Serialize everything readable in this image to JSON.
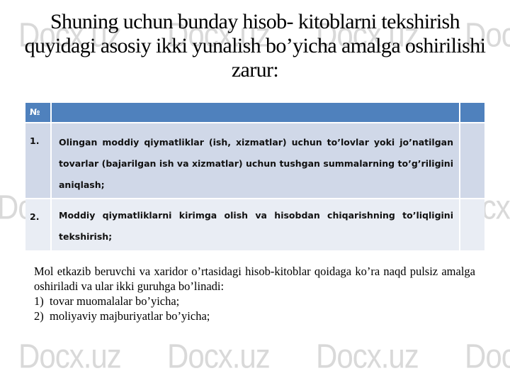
{
  "watermark": {
    "text": "Docx.uz"
  },
  "title": "Shuning uchun bunday hisob- kitoblarni tekshirish quyidagi asosiy ikki yunalish bo’yicha amalga oshirilishi zarur:",
  "table": {
    "header": {
      "num": "№",
      "text": "",
      "extra": ""
    },
    "rows": [
      {
        "num": "1.",
        "text": "Olingan moddiy qiymatliklar (ish, xizmatlar) uchun to’lovlar yoki jo’natilgan tovarlar (bajarilgan ish va xizmatlar) uchun tushgan summalarning to’g’riligini aniqlash;",
        "extra": ""
      },
      {
        "num": "2.",
        "text": "Moddiy qiymatliklarni kirimga olish va hisobdan chiqarishning to’liqligini tekshirish;",
        "extra": ""
      }
    ]
  },
  "body": {
    "paragraph": "Mol etkazib beruvchi va xaridor o’rtasidagi hisob-kitoblar qoidaga ko’ra naqd pulsiz amalga oshiriladi va ular ikki guruhga bo’linadi:",
    "list": [
      {
        "marker": "1)",
        "text": "tovar muomalalar bo’yicha;"
      },
      {
        "marker": "2)",
        "text": "moliyaviy majburiyatlar bo’yicha;"
      }
    ]
  },
  "colors": {
    "header_blue": "#4f81bd",
    "row1": "#d0d8e8",
    "row2": "#e9edf4",
    "watermark": "#d9d9d9"
  }
}
